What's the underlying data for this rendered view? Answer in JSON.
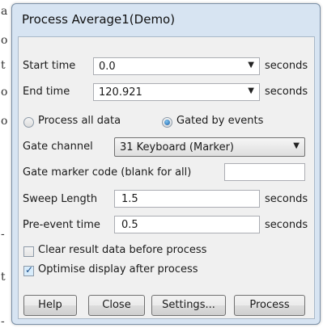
{
  "window": {
    "title": "Process Average1(Demo)"
  },
  "start_time": {
    "label": "Start time",
    "value": "0.0",
    "unit": "seconds"
  },
  "end_time": {
    "label": "End time",
    "value": "120.921",
    "unit": "seconds"
  },
  "mode": {
    "process_all_label": "Process all data",
    "gated_label": "Gated by events",
    "selected": "Gated by events"
  },
  "gate_channel": {
    "label": "Gate channel",
    "value": "31 Keyboard (Marker)"
  },
  "gate_marker": {
    "label": "Gate marker code (blank for all)",
    "value": ""
  },
  "sweep_length": {
    "label": "Sweep Length",
    "value": "1.5",
    "unit": "seconds"
  },
  "pre_event_time": {
    "label": "Pre-event time",
    "value": "0.5",
    "unit": "seconds"
  },
  "options": {
    "clear_label": "Clear result data before process",
    "clear_checked": false,
    "optimise_label": "Optimise display after process",
    "optimise_checked": true
  },
  "buttons": {
    "help": "Help",
    "close": "Close",
    "settings": "Settings...",
    "process": "Process"
  },
  "background_text": {
    "chars": [
      "a",
      "o",
      "t",
      "o",
      "o",
      "-",
      "t",
      "-"
    ]
  }
}
